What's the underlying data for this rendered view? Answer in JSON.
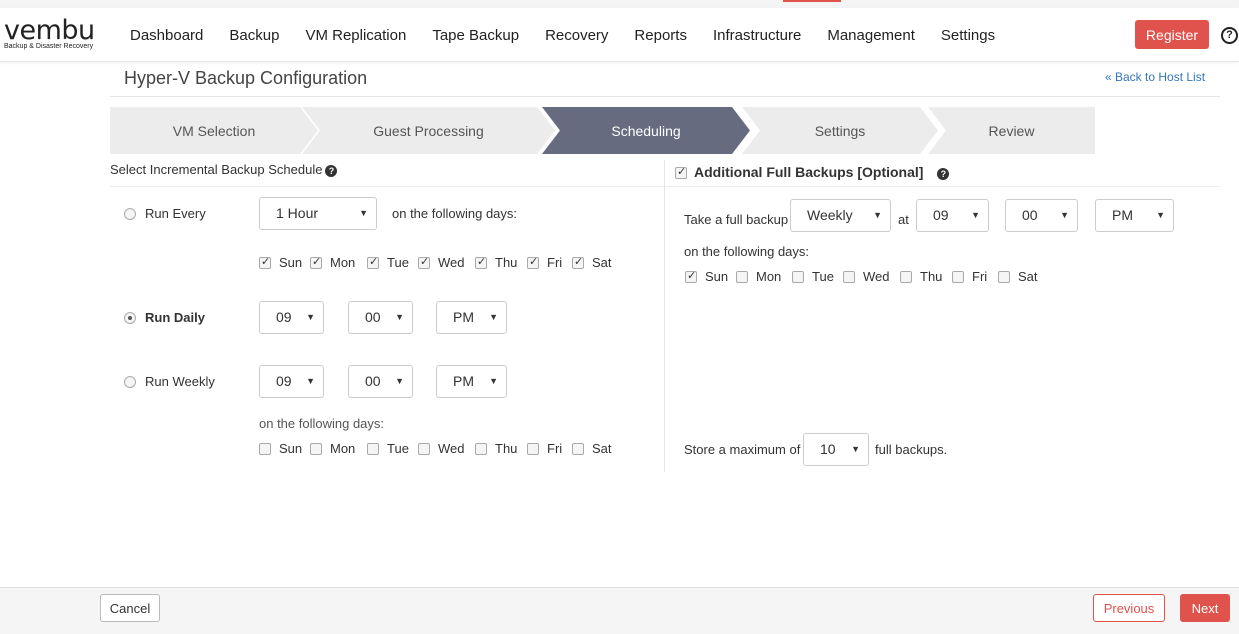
{
  "brand": {
    "name": "vembu",
    "tagline": "Backup & Disaster Recovery"
  },
  "nav": {
    "items": [
      "Dashboard",
      "Backup",
      "VM Replication",
      "Tape Backup",
      "Recovery",
      "Reports",
      "Infrastructure",
      "Management",
      "Settings"
    ],
    "register_label": "Register",
    "help_glyph": "?"
  },
  "page": {
    "title": "Hyper-V Backup Configuration",
    "back_link": "« Back to Host List"
  },
  "wizard": {
    "steps": [
      "VM Selection",
      "Guest Processing",
      "Scheduling",
      "Settings",
      "Review"
    ],
    "active": "Scheduling"
  },
  "incremental": {
    "title": "Select Incremental Backup Schedule",
    "run_every": {
      "label": "Run Every",
      "selected": false,
      "interval": "1 Hour",
      "days_label": "on the following days:",
      "days": [
        {
          "name": "Sun",
          "checked": true
        },
        {
          "name": "Mon",
          "checked": true
        },
        {
          "name": "Tue",
          "checked": true
        },
        {
          "name": "Wed",
          "checked": true
        },
        {
          "name": "Thu",
          "checked": true
        },
        {
          "name": "Fri",
          "checked": true
        },
        {
          "name": "Sat",
          "checked": true
        }
      ]
    },
    "run_daily": {
      "label": "Run Daily",
      "selected": true,
      "hour": "09",
      "minute": "00",
      "ampm": "PM"
    },
    "run_weekly": {
      "label": "Run Weekly",
      "selected": false,
      "hour": "09",
      "minute": "00",
      "ampm": "PM",
      "days_label": "on the following days:",
      "days": [
        {
          "name": "Sun",
          "checked": false
        },
        {
          "name": "Mon",
          "checked": false
        },
        {
          "name": "Tue",
          "checked": false
        },
        {
          "name": "Wed",
          "checked": false
        },
        {
          "name": "Thu",
          "checked": false
        },
        {
          "name": "Fri",
          "checked": false
        },
        {
          "name": "Sat",
          "checked": false
        }
      ]
    }
  },
  "full_backup": {
    "enabled": true,
    "title": "Additional Full Backups [Optional]",
    "take_label": "Take a full backup",
    "frequency": "Weekly",
    "at_label": "at",
    "hour": "09",
    "minute": "00",
    "ampm": "PM",
    "days_label": "on the following days:",
    "days": [
      {
        "name": "Sun",
        "checked": true
      },
      {
        "name": "Mon",
        "checked": false
      },
      {
        "name": "Tue",
        "checked": false
      },
      {
        "name": "Wed",
        "checked": false
      },
      {
        "name": "Thu",
        "checked": false
      },
      {
        "name": "Fri",
        "checked": false
      },
      {
        "name": "Sat",
        "checked": false
      }
    ],
    "store_prefix": "Store a maximum of",
    "store_count": "10",
    "store_suffix": "full backups."
  },
  "footer": {
    "cancel": "Cancel",
    "previous": "Previous",
    "next": "Next"
  },
  "colors": {
    "accent": "#e0524c",
    "active_step": "#666b7f",
    "link": "#3477b9"
  }
}
